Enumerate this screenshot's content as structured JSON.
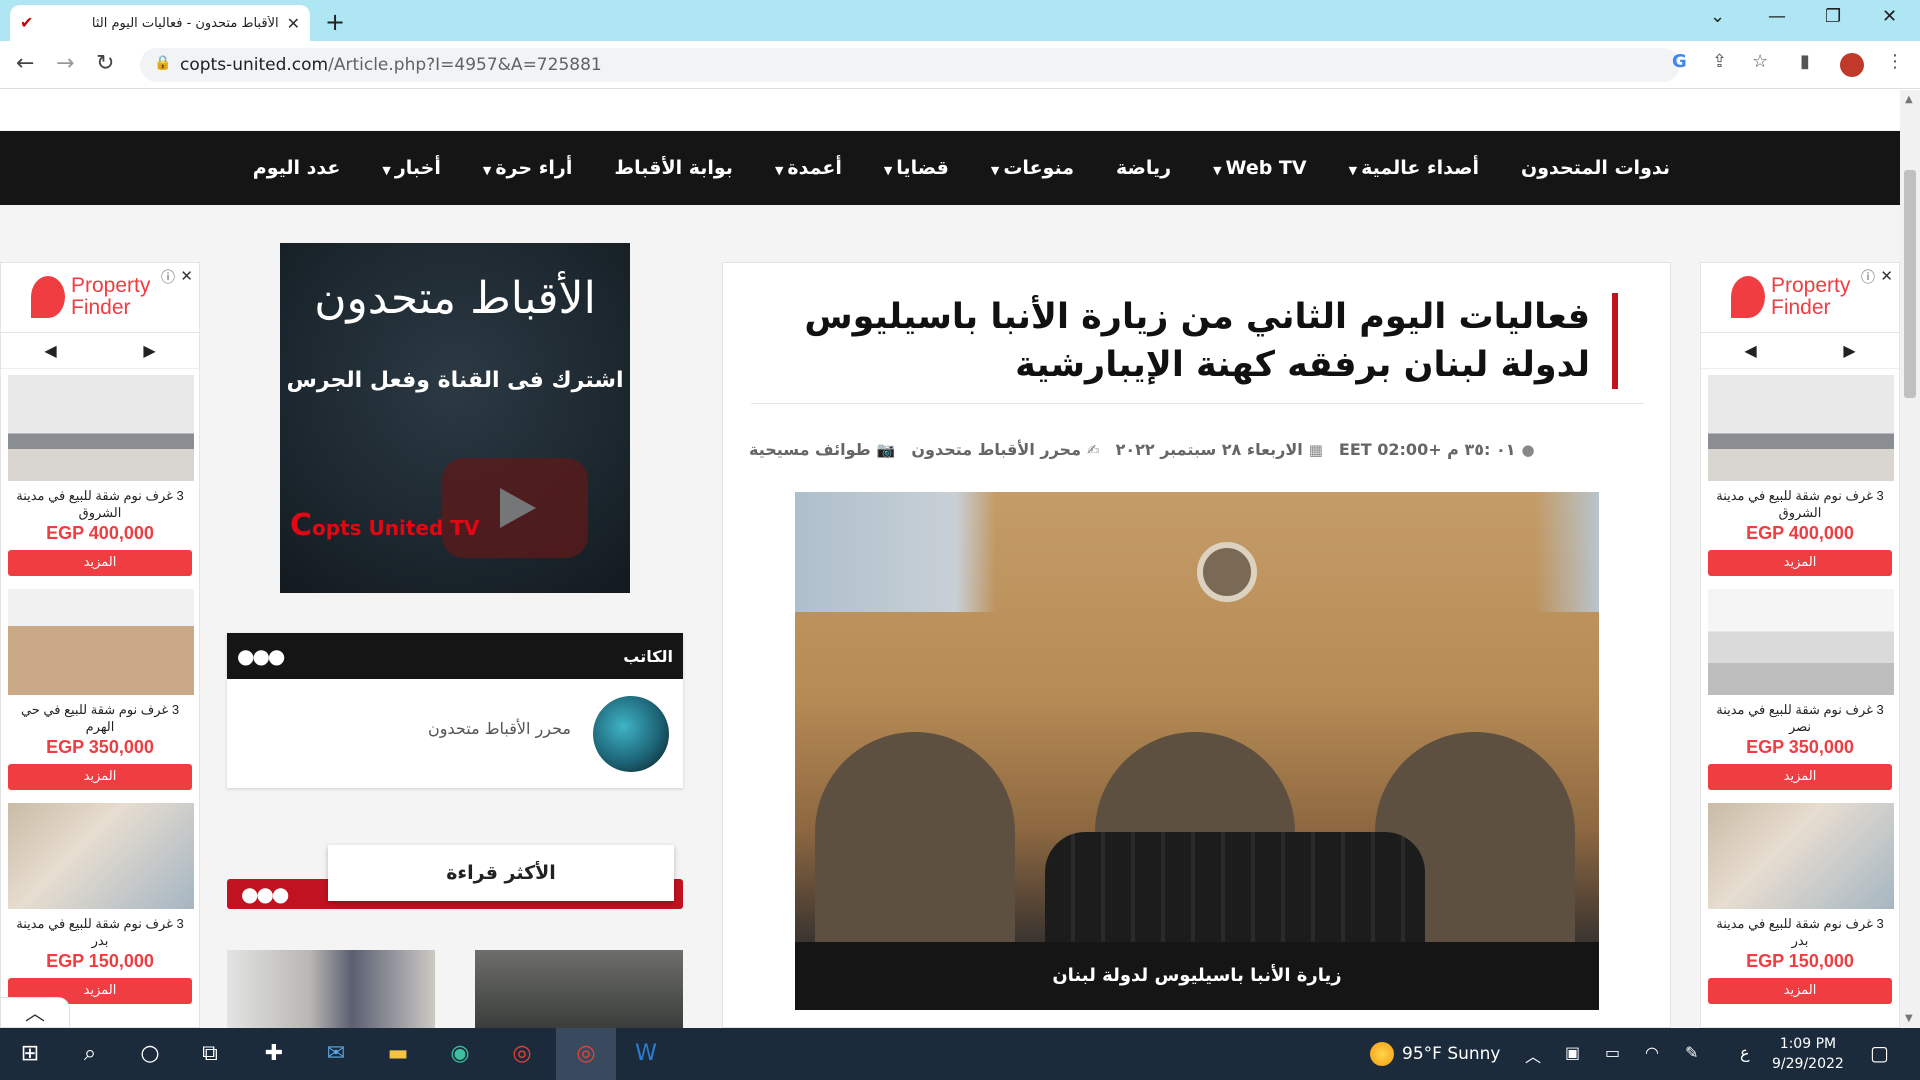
{
  "browser": {
    "tab_title": "الأقباط متحدون - فعاليات اليوم الثا",
    "url_host": "copts-united.com",
    "url_path": "/Article.php?I=4957&A=725881"
  },
  "menu": [
    {
      "label": "عدد اليوم",
      "caret": false
    },
    {
      "label": "أخبار",
      "caret": true
    },
    {
      "label": "أراء حرة",
      "caret": true
    },
    {
      "label": "بوابة الأقباط",
      "caret": false
    },
    {
      "label": "أعمدة",
      "caret": true
    },
    {
      "label": "قضايا",
      "caret": true
    },
    {
      "label": "منوعات",
      "caret": true
    },
    {
      "label": "رياضة",
      "caret": false
    },
    {
      "label": "Web TV",
      "caret": true
    },
    {
      "label": "أصداء عالمية",
      "caret": true
    },
    {
      "label": "ندوات المتحدون",
      "caret": false
    }
  ],
  "ads": {
    "brand_line1": "Property",
    "brand_line2": "Finder",
    "more_label": "المزيد",
    "left": [
      {
        "desc": "3 غرف نوم شقة للبيع في مدينة الشروق",
        "price": "EGP 400,000"
      },
      {
        "desc": "3 غرف نوم شقة للبيع في حي الهرم",
        "price": "EGP 350,000"
      },
      {
        "desc": "3 غرف نوم شقة للبيع في مدينة بدر",
        "price": "EGP 150,000"
      }
    ],
    "right": [
      {
        "desc": "3 غرف نوم شقة للبيع في مدينة الشروق",
        "price": "EGP 400,000"
      },
      {
        "desc": "3 غرف نوم شقة للبيع في مدينة نصر",
        "price": "EGP 350,000"
      },
      {
        "desc": "3 غرف نوم شقة للبيع في مدينة بدر",
        "price": "EGP 150,000"
      }
    ]
  },
  "youtube_promo": {
    "title": "الأقباط متحدون",
    "subtitle": "اشترك فى القناة وفعل الجرس",
    "logo_big": "C",
    "logo_small": "opts United TV"
  },
  "writer_box": {
    "label": "الكاتب",
    "name": "محرر الأقباط متحدون"
  },
  "most_read": {
    "label": "الأكثر قراءة"
  },
  "article": {
    "title": "فعاليات اليوم الثاني من زيارة الأنبا باسيليوس لدولة لبنان برفقه كهنة الإيبارشية",
    "category": "طوائف مسيحية",
    "author": "محرر الأقباط متحدون",
    "date": "الاربعاء ٢٨ سبتمبر ٢٠٢٢",
    "time": "٠١ :٣٥ م +02:00 EET",
    "caption": "زيارة الأنبا باسيليوس لدولة لبنان"
  },
  "taskbar": {
    "weather": "95°F  Sunny",
    "lang": "ع",
    "time": "1:09 PM",
    "date": "9/29/2022"
  }
}
